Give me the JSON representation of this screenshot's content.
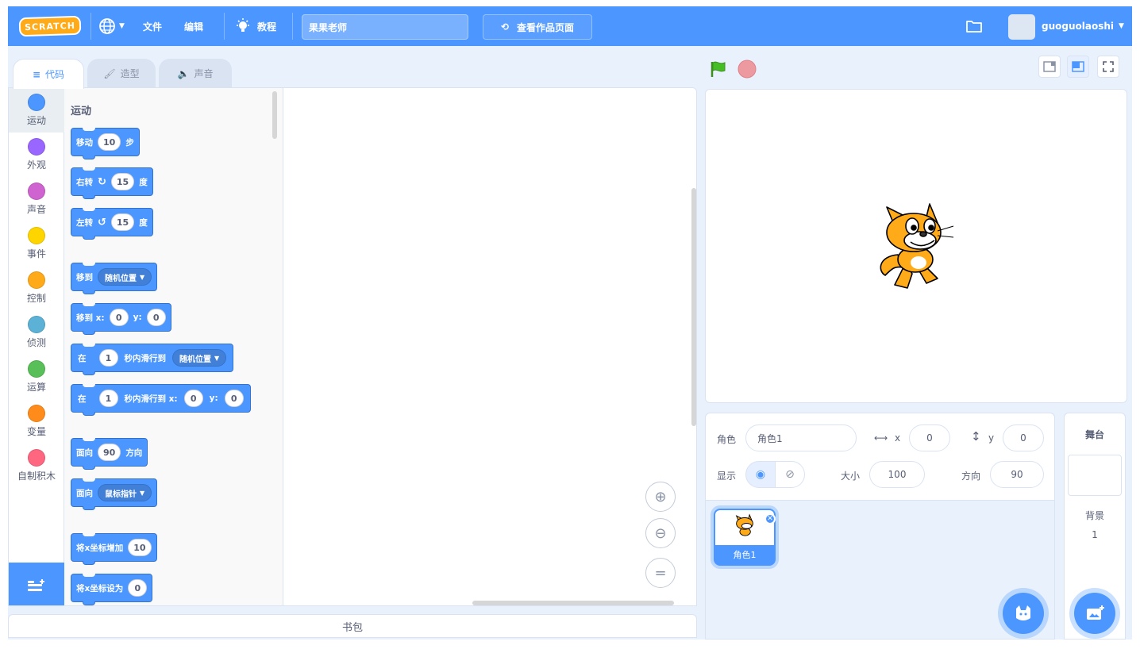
{
  "menu": {
    "logo": "SCRATCH",
    "language_icon": "globe-icon",
    "file": "文件",
    "edit": "编辑",
    "tutorials": "教程",
    "project_title": "果果老师",
    "see_project_page": "查看作品页面",
    "username": "guoguolaoshi"
  },
  "tabs": [
    {
      "label": "代码",
      "icon": "code-icon"
    },
    {
      "label": "造型",
      "icon": "brush-icon"
    },
    {
      "label": "声音",
      "icon": "speaker-icon"
    }
  ],
  "categories": [
    {
      "label": "运动",
      "color": "#4c97ff"
    },
    {
      "label": "外观",
      "color": "#9966ff"
    },
    {
      "label": "声音",
      "color": "#cf63cf"
    },
    {
      "label": "事件",
      "color": "#ffd500"
    },
    {
      "label": "控制",
      "color": "#ffab19"
    },
    {
      "label": "侦测",
      "color": "#5cb1d6"
    },
    {
      "label": "运算",
      "color": "#59c059"
    },
    {
      "label": "变量",
      "color": "#ff8c1a"
    },
    {
      "label": "自制积木",
      "color": "#ff6680"
    }
  ],
  "palette": {
    "section_title": "运动",
    "blocks": {
      "move": {
        "text": "移动",
        "value": "10",
        "suffix": "步"
      },
      "turn_right": {
        "text": "右转",
        "value": "15",
        "suffix": "度"
      },
      "turn_left": {
        "text": "左转",
        "value": "15",
        "suffix": "度"
      },
      "goto": {
        "text": "移到",
        "dropdown": "随机位置"
      },
      "goto_xy": {
        "text": "移到 x:",
        "x": "0",
        "ylabel": "y:",
        "y": "0"
      },
      "glide": {
        "text": "在",
        "value": "1",
        "middle": "秒内滑行到",
        "dropdown": "随机位置"
      },
      "glide_xy": {
        "text": "在",
        "value": "1",
        "middle": "秒内滑行到 x:",
        "x": "0",
        "ylabel": "y:",
        "y": "0"
      },
      "point_direction": {
        "text": "面向",
        "value": "90",
        "suffix": "方向"
      },
      "point_towards": {
        "text": "面向",
        "dropdown": "鼠标指针"
      },
      "change_x": {
        "text": "将x坐标增加",
        "value": "10"
      },
      "set_x": {
        "text": "将x坐标设为",
        "value": "0"
      }
    }
  },
  "backpack": "书包",
  "sprite_info": {
    "sprite_label": "角色",
    "sprite_name": "角色1",
    "x_label": "x",
    "x_value": "0",
    "y_label": "y",
    "y_value": "0",
    "show_label": "显示",
    "size_label": "大小",
    "size_value": "100",
    "direction_label": "方向",
    "direction_value": "90"
  },
  "sprites": [
    {
      "name": "角色1"
    }
  ],
  "stage_pane": {
    "title": "舞台",
    "backdrops_label": "背景",
    "backdrops_count": "1"
  },
  "colors": {
    "accent": "#4c97ff",
    "motion": "#4c97ff",
    "flag": "#45bd25",
    "stop": "#ec5959"
  }
}
